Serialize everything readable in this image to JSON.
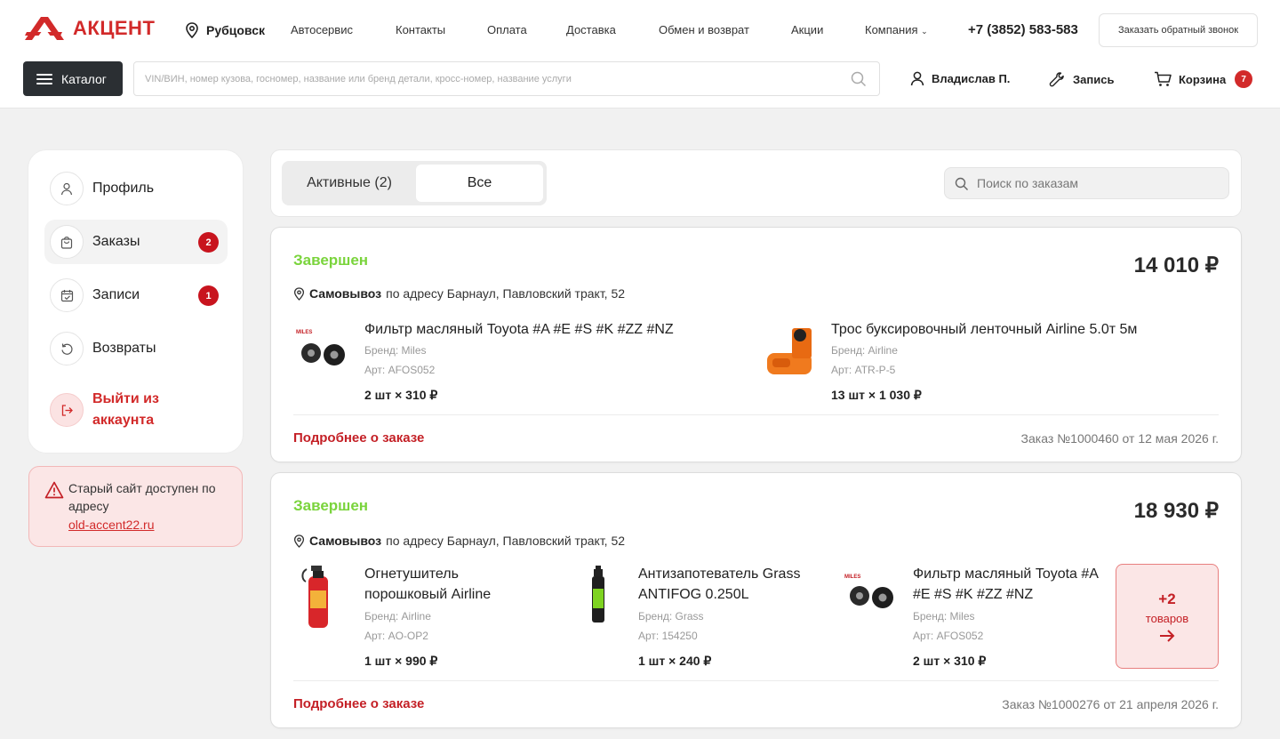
{
  "header": {
    "logo_text": "АКЦЕНТ",
    "city": "Рубцовск",
    "nav": [
      "Автосервис",
      "Контакты",
      "Оплата",
      "Доставка",
      "Обмен и возврат",
      "Акции",
      "Компания"
    ],
    "phone": "+7 (3852) 583-583",
    "callback_label": "Заказать обратный звонок",
    "catalog_label": "Каталог",
    "search_placeholder": "VIN/ВИН, номер кузова, госномер, название или бренд детали, кросс-номер, название услуги",
    "user_name": "Владислав П.",
    "booking_label": "Запись",
    "cart_label": "Корзина",
    "cart_count": "7",
    "brand_color": "#d22a2a"
  },
  "sidebar": {
    "items": [
      {
        "label": "Профиль",
        "icon": "user-icon"
      },
      {
        "label": "Заказы",
        "icon": "bag-icon",
        "badge": "2"
      },
      {
        "label": "Записи",
        "icon": "calendar-check-icon",
        "badge": "1"
      },
      {
        "label": "Возвраты",
        "icon": "return-icon"
      },
      {
        "label": "Выйти из аккаунта",
        "icon": "logout-icon"
      }
    ],
    "notice_text": "Старый сайт доступен по адресу",
    "notice_link": "old-accent22.ru"
  },
  "orders_toolbar": {
    "tab_active": "Активные (2)",
    "tab_all": "Все",
    "search_placeholder": "Поиск по заказам"
  },
  "orders": [
    {
      "status": "Завершен",
      "status_color": "#7ad43c",
      "total": "14 010 ₽",
      "delivery_type": "Самовывоз",
      "address": "по адресу Барнаул, Павловский тракт, 52",
      "items": [
        {
          "name": "Фильтр масляный Toyota #A #E #S #K #ZZ #NZ",
          "brand": "Бренд: Miles",
          "article": "Арт: AFOS052",
          "qty": "2 шт × 310 ₽"
        },
        {
          "name": "Трос буксировочный ленточный Airline 5.0т 5м",
          "brand": "Бренд: Airline",
          "article": "Арт: ATR-P-5",
          "qty": "13 шт × 1 030 ₽"
        }
      ],
      "details_label": "Подробнее о заказе",
      "order_info": "Заказ №1000460 от 12 мая 2026 г."
    },
    {
      "status": "Завершен",
      "status_color": "#7ad43c",
      "total": "18 930 ₽",
      "delivery_type": "Самовывоз",
      "address": "по адресу Барнаул, Павловский тракт, 52",
      "items": [
        {
          "name": "Огнетушитель порошковый Airline",
          "brand": "Бренд: Airline",
          "article": "Арт: AO-OP2",
          "qty": "1 шт × 990 ₽"
        },
        {
          "name": "Антизапотеватель Grass ANTIFOG 0.250L",
          "brand": "Бренд: Grass",
          "article": "Арт: 154250",
          "qty": "1 шт × 240 ₽"
        },
        {
          "name": "Фильтр масляный Toyota #A #E #S #K #ZZ #NZ",
          "brand": "Бренд: Miles",
          "article": "Арт: AFOS052",
          "qty": "2 шт × 310 ₽"
        }
      ],
      "more_count": "+2",
      "more_label": "товаров",
      "details_label": "Подробнее о заказе",
      "order_info": "Заказ №1000276 от 21 апреля 2026 г."
    }
  ]
}
